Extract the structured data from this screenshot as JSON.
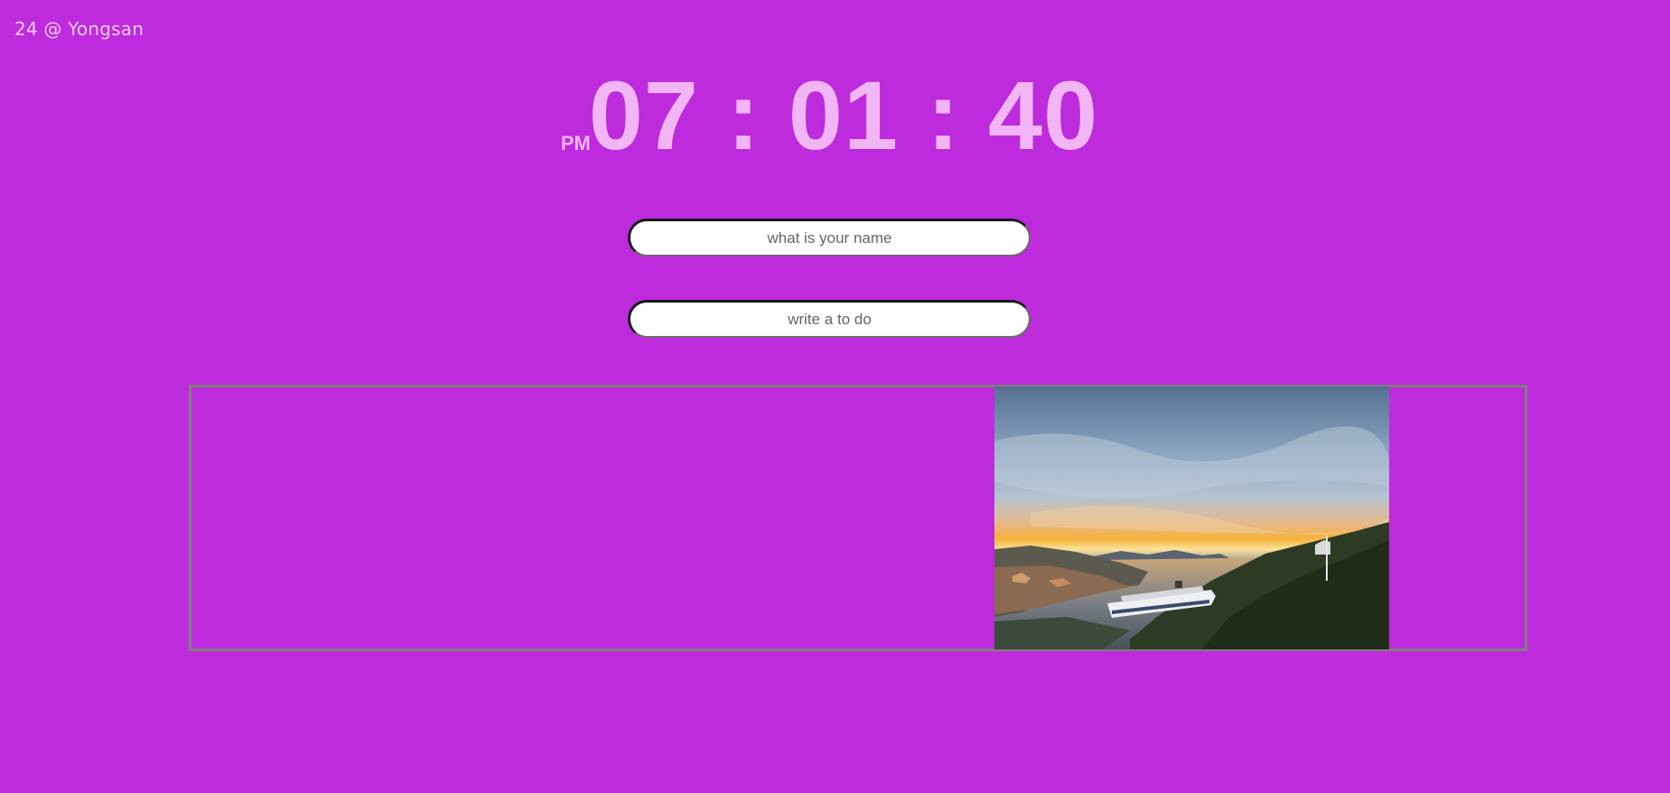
{
  "weather": {
    "text": "24 @ Yongsan"
  },
  "clock": {
    "ampm": "PM",
    "time": "07 : 01 : 40"
  },
  "name_input": {
    "placeholder": "what is your name"
  },
  "todo_input": {
    "placeholder": "write a to do"
  },
  "colors": {
    "background": "#be2bdc",
    "clock_text": "#f2b6f6",
    "weather_text": "#f0c8f6",
    "box_border": "#7f7f7f"
  },
  "background_image": {
    "icon": "sunset-harbor-photo"
  }
}
